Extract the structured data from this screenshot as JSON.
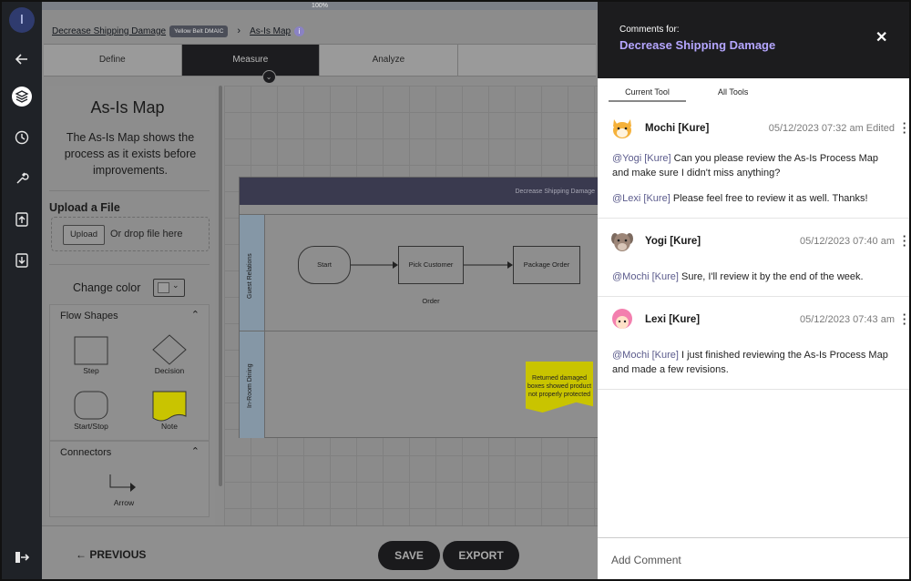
{
  "rail": {
    "avatar_initial": "I",
    "icons": [
      "arrow-left-icon",
      "layers-icon",
      "clock-icon",
      "wrench-icon",
      "upload-icon",
      "download-icon",
      "logout-icon"
    ]
  },
  "progress": {
    "label": "100%",
    "value": 100
  },
  "breadcrumb": {
    "project": "Decrease Shipping Damage",
    "badge": "Yellow Belt DMAIC",
    "separator": "›",
    "current": "As-Is Map",
    "info_icon": "info-icon"
  },
  "tabs": [
    {
      "label": "Define"
    },
    {
      "label": "Measure"
    },
    {
      "label": "Analyze"
    },
    {
      "label": ""
    }
  ],
  "panel": {
    "title": "As-Is Map",
    "description": "The As-Is Map shows the process as it exists before improvements.",
    "upload_title": "Upload a File",
    "upload_button": "Upload",
    "drop_text": "Or drop file here",
    "change_color": "Change color",
    "flow_shapes": {
      "header": "Flow Shapes",
      "shapes": [
        "Step",
        "Decision",
        "Start/Stop",
        "Note"
      ]
    },
    "connectors": {
      "header": "Connectors",
      "items": [
        "Arrow"
      ]
    }
  },
  "diagram": {
    "pool_title": "Decrease Shipping Damage",
    "lanes": [
      "Guest Relations",
      "In-Room Dining"
    ],
    "nodes": [
      "Start",
      "Pick Customer Order",
      "Package Order"
    ],
    "note": "Returned damaged boxes showed product not properly protected"
  },
  "bottom": {
    "previous": "PREVIOUS",
    "save": "SAVE",
    "export": "EXPORT"
  },
  "comments_panel": {
    "heading": "Comments for:",
    "project": "Decrease Shipping Damage",
    "close": "✕",
    "tabs": [
      "Current Tool",
      "All Tools"
    ],
    "comments": [
      {
        "author": "Mochi [Kure]",
        "timestamp": "05/12/2023 07:32 am Edited",
        "paragraphs": [
          {
            "mention": "@Yogi [Kure]",
            "text": "Can you please review the As-Is Process Map and make sure I didn't miss anything?"
          },
          {
            "mention": "@Lexi [Kure]",
            "text": "Please feel free to review it as well. Thanks!"
          }
        ],
        "avatar_color": "#f5b13a"
      },
      {
        "author": "Yogi [Kure]",
        "timestamp": "05/12/2023 07:40 am",
        "paragraphs": [
          {
            "mention": "@Mochi [Kure]",
            "text": "Sure, I'll review it by the end of the week."
          }
        ],
        "avatar_color": "#9c8577"
      },
      {
        "author": "Lexi [Kure]",
        "timestamp": "05/12/2023 07:43 am",
        "paragraphs": [
          {
            "mention": "@Mochi [Kure]",
            "text": "I just finished reviewing the As-Is Process Map and made a few revisions."
          }
        ],
        "avatar_color": "#f37fae"
      }
    ],
    "add_comment": "Add Comment"
  }
}
